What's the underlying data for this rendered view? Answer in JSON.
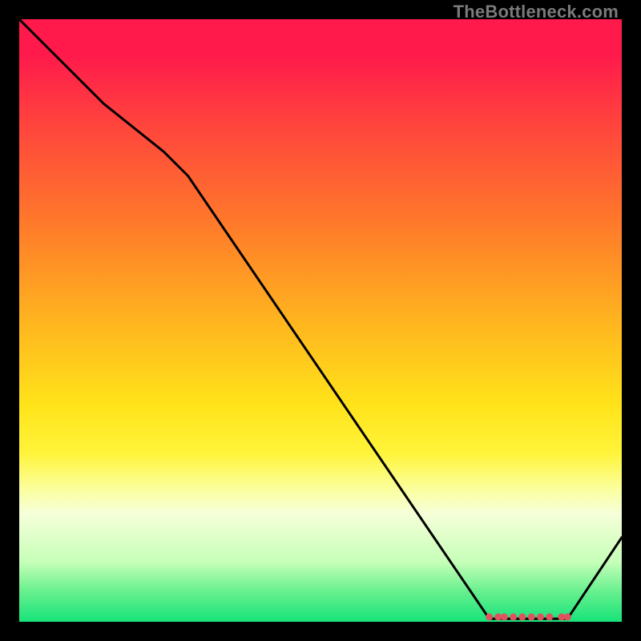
{
  "watermark": "TheBottleneck.com",
  "chart_data": {
    "type": "line",
    "title": "",
    "xlabel": "",
    "ylabel": "",
    "xlim": [
      0,
      100
    ],
    "ylim": [
      0,
      100
    ],
    "plateau_range_x": [
      78,
      91
    ],
    "curve": [
      {
        "x": 0,
        "y": 100
      },
      {
        "x": 14,
        "y": 86
      },
      {
        "x": 24,
        "y": 78
      },
      {
        "x": 28,
        "y": 74
      },
      {
        "x": 78,
        "y": 0.5
      },
      {
        "x": 91,
        "y": 0.5
      },
      {
        "x": 100,
        "y": 14
      }
    ],
    "markers": [
      {
        "x": 78.0,
        "y": 0.8
      },
      {
        "x": 79.5,
        "y": 0.8
      },
      {
        "x": 80.5,
        "y": 0.8
      },
      {
        "x": 82.0,
        "y": 0.8
      },
      {
        "x": 83.5,
        "y": 0.8
      },
      {
        "x": 85.0,
        "y": 0.8
      },
      {
        "x": 86.5,
        "y": 0.8
      },
      {
        "x": 88.0,
        "y": 0.8
      },
      {
        "x": 90.0,
        "y": 0.8
      },
      {
        "x": 91.0,
        "y": 0.8
      }
    ]
  }
}
